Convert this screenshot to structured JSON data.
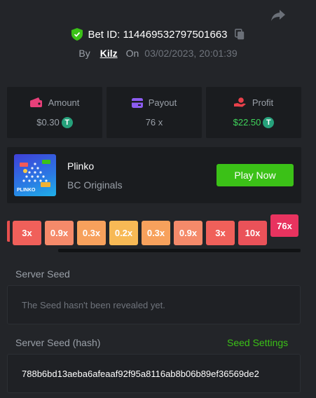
{
  "header": {
    "bet_id_label": "Bet ID: 114469532797501663",
    "by_label": "By",
    "username": "Kilz",
    "on_label": "On",
    "date": "03/02/2023, 20:01:39"
  },
  "stats": {
    "amount": {
      "label": "Amount",
      "value": "$0.30",
      "icon": "wallet-icon",
      "icon_color": "#e8407a"
    },
    "payout": {
      "label": "Payout",
      "value": "76 x",
      "icon": "card-icon",
      "icon_color": "#8c5cf0"
    },
    "profit": {
      "label": "Profit",
      "value": "$22.50",
      "icon": "hand-coin-icon",
      "icon_color": "#e8404a"
    },
    "currency_symbol": "T",
    "profit_color": "#3fd35a"
  },
  "game": {
    "title": "Plinko",
    "provider": "BC Originals",
    "play_label": "Play Now",
    "thumbnail_label": "PLINKO"
  },
  "multipliers": [
    {
      "label": "3x",
      "color": "#f0605a"
    },
    {
      "label": "0.9x",
      "color": "#f58a6a"
    },
    {
      "label": "0.3x",
      "color": "#f7a15c"
    },
    {
      "label": "0.2x",
      "color": "#f7b955"
    },
    {
      "label": "0.3x",
      "color": "#f7a15c"
    },
    {
      "label": "0.9x",
      "color": "#f58a6a"
    },
    {
      "label": "3x",
      "color": "#f0605a"
    },
    {
      "label": "10x",
      "color": "#ea5259"
    },
    {
      "label": "76x",
      "color": "#e8335f",
      "hit": true
    }
  ],
  "server_seed": {
    "label": "Server Seed",
    "value": "The Seed hasn't been revealed yet."
  },
  "server_seed_hash": {
    "label": "Server Seed (hash)",
    "link": "Seed Settings",
    "value": "788b6bd13aeba6afeaaf92f95a8116ab8b06b89ef36569de2"
  }
}
